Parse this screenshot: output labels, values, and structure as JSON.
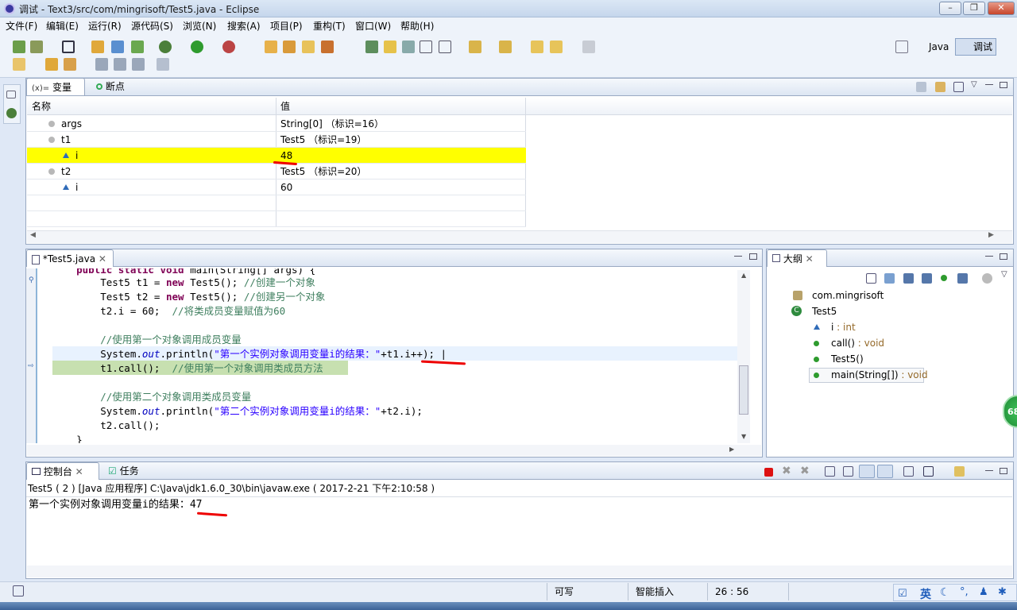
{
  "window": {
    "title": "调试 - Text3/src/com/mingrisoft/Test5.java - Eclipse"
  },
  "menu": [
    "文件(F)",
    "编辑(E)",
    "运行(R)",
    "源代码(S)",
    "浏览(N)",
    "搜索(A)",
    "项目(P)",
    "重构(T)",
    "窗口(W)",
    "帮助(H)"
  ],
  "perspectives": {
    "java": "Java",
    "debug": "调试"
  },
  "variables": {
    "tabs": {
      "vars": "变量",
      "breakpoints": "断点"
    },
    "header": {
      "name": "名称",
      "value": "值"
    },
    "rows": [
      {
        "name": "args",
        "value": "String[0]  （标识=16）"
      },
      {
        "name": "t1",
        "value": "Test5  （标识=19）"
      },
      {
        "name": "i",
        "value": "48"
      },
      {
        "name": "t2",
        "value": "Test5  （标识=20）"
      },
      {
        "name": "i",
        "value": "60"
      }
    ]
  },
  "editor": {
    "tab": "*Test5.java",
    "lines": [
      "    public static void main(String[] args) {",
      "        Test5 t1 = new Test5(); //创建一个对象",
      "        Test5 t2 = new Test5(); //创建另一个对象",
      "        t2.i = 60;  //将类成员变量赋值为60",
      "",
      "        //使用第一个对象调用成员变量",
      "        System.out.println(\"第一个实例对象调用变量i的结果：\"+t1.i++);",
      "        t1.call();  //使用第一个对象调用类成员方法",
      "",
      "        //使用第二个对象调用类成员变量",
      "        System.out.println(\"第二个实例对象调用变量i的结果：\"+t2.i);",
      "        t2.call();",
      "    }"
    ]
  },
  "outline": {
    "tab": "大纲",
    "items": [
      {
        "label": "com.mingrisoft",
        "type": ""
      },
      {
        "label": "Test5",
        "type": ""
      },
      {
        "label": "i",
        "type": " : int"
      },
      {
        "label": "call()",
        "type": " : void"
      },
      {
        "label": "Test5()",
        "type": ""
      },
      {
        "label": "main(String[])",
        "type": " : void"
      }
    ]
  },
  "console": {
    "tabs": {
      "console": "控制台",
      "tasks": "任务"
    },
    "launch": "Test5 ( 2 ) [Java 应用程序] C:\\Java\\jdk1.6.0_30\\bin\\javaw.exe ( 2017-2-21 下午2:10:58 )",
    "output": "第一个实例对象调用变量i的结果：47"
  },
  "status": {
    "writable": "可写",
    "insert": "智能插入",
    "position": "26 : 56"
  },
  "tray": {
    "ime": "英",
    "badge": "68"
  },
  "colors": {
    "highlight": "#ffff00",
    "current_line": "#c7e0b0",
    "accent_red": "#e00000"
  }
}
